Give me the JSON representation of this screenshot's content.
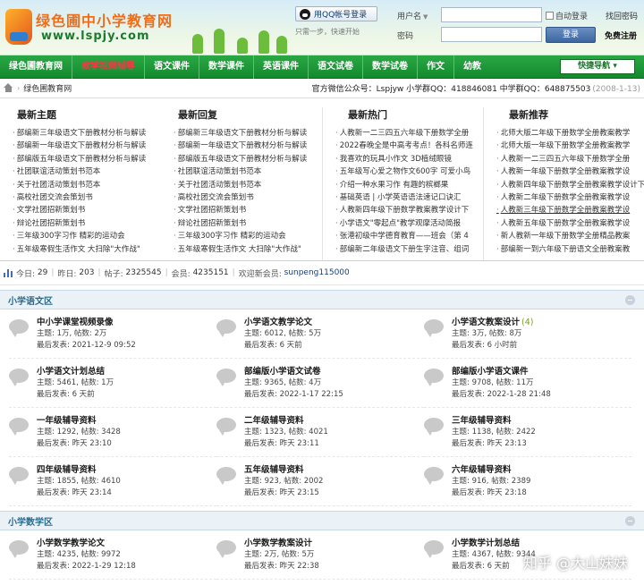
{
  "header": {
    "logo_title": "绿色圃中小学教育网",
    "logo_url": "www.lspjy.com",
    "qq_login": "用QQ帐号登录",
    "qq_note": "只需一步，快速开始",
    "username_label": "用户名",
    "password_label": "密码",
    "remember_label": "自动登录",
    "find_password": "找回密码",
    "login_button": "登录",
    "free_register": "免费注册"
  },
  "nav": {
    "items": [
      "绿色圃教育网",
      "教学视频辅导",
      "语文课件",
      "数学课件",
      "英语课件",
      "语文试卷",
      "数学试卷",
      "作文",
      "幼教"
    ],
    "quick_nav": "快捷导航"
  },
  "breadcrumb": {
    "site": "绿色圃教育网",
    "info": "官方微信公众号：Lspjyw 小学群QQ：418846081 中学群QQ：648875503",
    "date": "(2008-1-13)"
  },
  "lists": [
    {
      "title": "最新主题",
      "items": [
        "部编新三年级语文下册教材分析与解读",
        "部编新一年级语文下册教材分析与解读",
        "部编版五年级语文下册教材分析与解读",
        "社团联谊活动策划书范本",
        "关于社团活动策划书范本",
        "高校社团交流会策划书",
        "文学社团招新策划书",
        "辩论社团招新策划书",
        "三年级300字习作 精彩的运动会",
        "五年级寒假生活作文 大扫除\"大作战\""
      ]
    },
    {
      "title": "最新回复",
      "items": [
        "部编新三年级语文下册教材分析与解读",
        "部编新一年级语文下册教材分析与解读",
        "部编版五年级语文下册教材分析与解读",
        "社团联谊活动策划书范本",
        "关于社团活动策划书范本",
        "高校社团交流会策划书",
        "文学社团招新策划书",
        "辩论社团招新策划书",
        "三年级300字习作 精彩的运动会",
        "五年级寒假生活作文 大扫除\"大作战\""
      ]
    },
    {
      "title": "最新热门",
      "items": [
        "人教新一二三四五六年级下册数学全册",
        "2022春晚全是中高考考点！各科名师连",
        "我喜欢的玩具小作文 3D植绒眼镜",
        "五年级写心爱之物作文600字 可爱小鸟",
        "介绍一种水果习作 有趣的槟榔果",
        "基础英语 | 小学英语语法速记口诀汇",
        "人教新四年级下册数学教案教学设计下",
        "小学语文\"零起点\"教学观摩活动简报",
        "张港初级中学德育教育——班会（第 4",
        "部编新二年级语文下册生字注音、组词"
      ]
    },
    {
      "title": "最新推荐",
      "items": [
        "北师大版二年级下册数学全册教案教学",
        "北师大版一年级下册数学全册教案教学",
        "人教新一二三四五六年级下册数学全册",
        "人教新一年级下册数学全册教案教学设",
        "人教新四年级下册数学全册教案教学设计下",
        "人教新二年级下册数学全册教案教学设",
        "人教新三年级下册数学全册教案教学设",
        "人教新五年级下册数学全册教案教学设",
        "新人教新一年级下册数学全册精品教案",
        "部编新一到六年级下册语文全册教案教"
      ]
    }
  ],
  "stats": {
    "today_label": "今日:",
    "today": "29",
    "yesterday_label": "昨日:",
    "yesterday": "203",
    "posts_label": "帖子:",
    "posts": "2325545",
    "members_label": "会员:",
    "members": "4235151",
    "welcome_label": "欢迎新会员:",
    "new_member": "sunpeng115000"
  },
  "sections": [
    {
      "title": "小学语文区",
      "forums": [
        {
          "name": "中小学课堂视频录像",
          "badge": "",
          "stats": "主题: 1万, 帖数: 2万",
          "last": "最后发表: 2021-12-9 09:52"
        },
        {
          "name": "小学语文教学论文",
          "badge": "",
          "stats": "主题: 6012, 帖数: 5万",
          "last": "最后发表: 6 天前"
        },
        {
          "name": "小学语文教案设计",
          "badge": "(4)",
          "stats": "主题: 3万, 帖数: 8万",
          "last": "最后发表: 6 小时前"
        },
        {
          "name": "小学语文计划总结",
          "badge": "",
          "stats": "主题: 5461, 帖数: 1万",
          "last": "最后发表: 6 天前"
        },
        {
          "name": "部编版小学语文试卷",
          "badge": "",
          "stats": "主题: 9365, 帖数: 4万",
          "last": "最后发表: 2022-1-17 22:15"
        },
        {
          "name": "部编版小学语文课件",
          "badge": "",
          "stats": "主题: 9708, 帖数: 11万",
          "last": "最后发表: 2022-1-28 21:48"
        },
        {
          "name": "一年级辅导资料",
          "badge": "",
          "stats": "主题: 1292, 帖数: 3428",
          "last": "最后发表: 昨天 23:10"
        },
        {
          "name": "二年级辅导资料",
          "badge": "",
          "stats": "主题: 1323, 帖数: 4021",
          "last": "最后发表: 昨天 23:11"
        },
        {
          "name": "三年级辅导资料",
          "badge": "",
          "stats": "主题: 1138, 帖数: 2422",
          "last": "最后发表: 昨天 23:13"
        },
        {
          "name": "四年级辅导资料",
          "badge": "",
          "stats": "主题: 1855, 帖数: 4610",
          "last": "最后发表: 昨天 23:14"
        },
        {
          "name": "五年级辅导资料",
          "badge": "",
          "stats": "主题: 923, 帖数: 2002",
          "last": "最后发表: 昨天 23:15"
        },
        {
          "name": "六年级辅导资料",
          "badge": "",
          "stats": "主题: 916, 帖数: 2389",
          "last": "最后发表: 昨天 23:18"
        }
      ]
    },
    {
      "title": "小学数学区",
      "forums": [
        {
          "name": "小学数学教学论文",
          "badge": "",
          "stats": "主题: 4235, 帖数: 9972",
          "last": "最后发表: 2022-1-29 12:18"
        },
        {
          "name": "小学数学教案设计",
          "badge": "",
          "stats": "主题: 2万, 帖数: 5万",
          "last": "最后发表: 昨天 22:38"
        },
        {
          "name": "小学数学计划总结",
          "badge": "",
          "stats": "主题: 4367, 帖数: 9344",
          "last": "最后发表: 6 天前"
        }
      ]
    }
  ],
  "watermark": "知乎 @大山妹妹"
}
